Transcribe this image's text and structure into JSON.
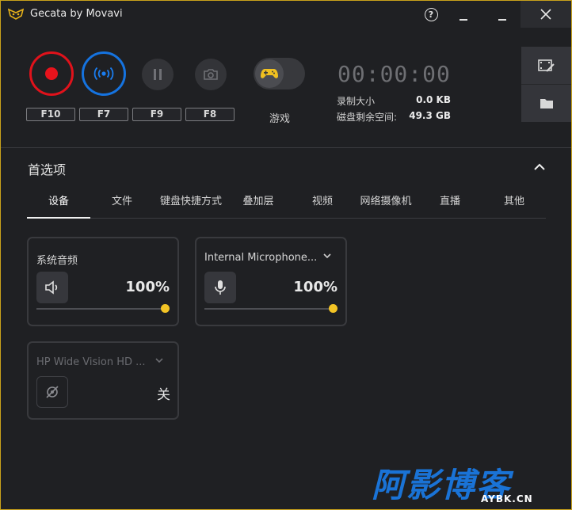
{
  "app": {
    "title": "Gecata by Movavi"
  },
  "titlebar": {
    "help_label": "?"
  },
  "controls": {
    "hotkeys": {
      "record": "F10",
      "stream": "F7",
      "pause": "F9",
      "screenshot": "F8"
    },
    "game_mode_label": "游戏",
    "timer": "00:00:00",
    "recording_size_label": "录制大小",
    "recording_size_value": "0.0 KB",
    "disk_free_label": "磁盘剩余空间:",
    "disk_free_value": "49.3 GB"
  },
  "preferences": {
    "title": "首选项",
    "tabs": [
      "设备",
      "文件",
      "键盘快捷方式",
      "叠加层",
      "视频",
      "网络摄像机",
      "直播",
      "其他"
    ],
    "active_tab": 0
  },
  "devices": {
    "system_audio": {
      "title": "系统音频",
      "volume_text": "100%",
      "volume": 1.0
    },
    "microphone": {
      "title": "Internal Microphone...",
      "volume_text": "100%",
      "volume": 1.0
    },
    "webcam": {
      "title": "HP Wide Vision HD ...",
      "status_text": "关"
    }
  },
  "colors": {
    "accent_record": "#e0121b",
    "accent_stream": "#1573e0",
    "slider_knob": "#f3c425",
    "window_border": "#c9a21b"
  },
  "watermark": {
    "text": "阿影博客",
    "sub": "AYBK.CN"
  }
}
